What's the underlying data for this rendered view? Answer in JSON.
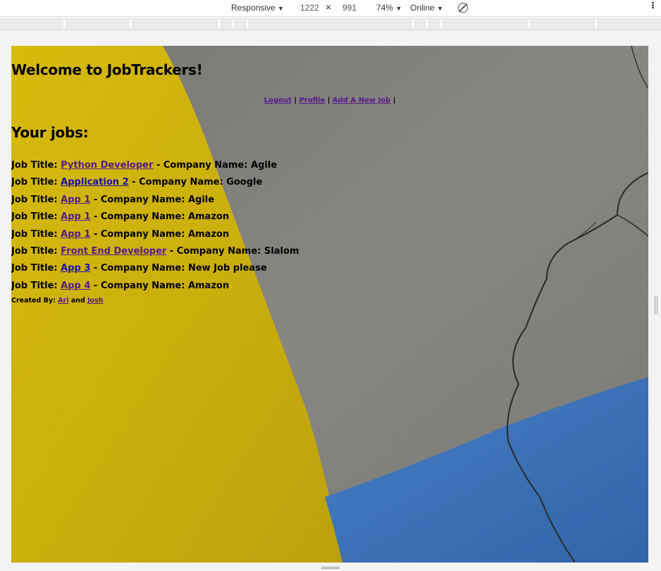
{
  "devtools": {
    "device": "Responsive",
    "width": "1222",
    "times": "×",
    "height": "991",
    "zoom": "74%",
    "network": "Online",
    "caret": "▼"
  },
  "page": {
    "welcome": "Welcome to JobTrackers!",
    "nav": {
      "logout": "Logout",
      "profile": "Profile",
      "add_job": "Add A New Job",
      "sep": "|"
    },
    "jobs_heading": "Your jobs:",
    "job_prefix": "Job Title:",
    "company_prefix": "- Company Name:",
    "jobs": [
      {
        "title": "Python Developer",
        "company": "Agile",
        "visited": true
      },
      {
        "title": "Application 2",
        "company": "Google",
        "visited": false
      },
      {
        "title": "App 1",
        "company": "Agile",
        "visited": true
      },
      {
        "title": "App 1",
        "company": "Amazon",
        "visited": true
      },
      {
        "title": "App 1",
        "company": "Amazon",
        "visited": true
      },
      {
        "title": "Front End Developer",
        "company": "Slalom",
        "visited": true
      },
      {
        "title": "App 3",
        "company": "New Job please",
        "visited": false
      },
      {
        "title": "App 4",
        "company": "Amazon",
        "visited": true
      }
    ],
    "credit": {
      "prefix": "Created By:",
      "author1": "Ari",
      "and": "and",
      "author2": "Josh"
    }
  },
  "colors": {
    "link_visited": "#551a8b",
    "link_unvisited": "#1a0dab",
    "yellow_paint": "#d6b80c",
    "blue_paint": "#3d78c4",
    "concrete": "#8c8a86"
  }
}
